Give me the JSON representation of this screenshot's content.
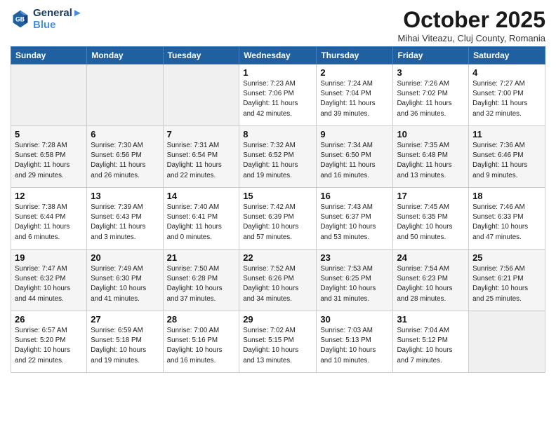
{
  "header": {
    "logo_line1": "General",
    "logo_line2": "Blue",
    "month": "October 2025",
    "location": "Mihai Viteazu, Cluj County, Romania"
  },
  "weekdays": [
    "Sunday",
    "Monday",
    "Tuesday",
    "Wednesday",
    "Thursday",
    "Friday",
    "Saturday"
  ],
  "weeks": [
    [
      {
        "day": "",
        "info": ""
      },
      {
        "day": "",
        "info": ""
      },
      {
        "day": "",
        "info": ""
      },
      {
        "day": "1",
        "info": "Sunrise: 7:23 AM\nSunset: 7:06 PM\nDaylight: 11 hours\nand 42 minutes."
      },
      {
        "day": "2",
        "info": "Sunrise: 7:24 AM\nSunset: 7:04 PM\nDaylight: 11 hours\nand 39 minutes."
      },
      {
        "day": "3",
        "info": "Sunrise: 7:26 AM\nSunset: 7:02 PM\nDaylight: 11 hours\nand 36 minutes."
      },
      {
        "day": "4",
        "info": "Sunrise: 7:27 AM\nSunset: 7:00 PM\nDaylight: 11 hours\nand 32 minutes."
      }
    ],
    [
      {
        "day": "5",
        "info": "Sunrise: 7:28 AM\nSunset: 6:58 PM\nDaylight: 11 hours\nand 29 minutes."
      },
      {
        "day": "6",
        "info": "Sunrise: 7:30 AM\nSunset: 6:56 PM\nDaylight: 11 hours\nand 26 minutes."
      },
      {
        "day": "7",
        "info": "Sunrise: 7:31 AM\nSunset: 6:54 PM\nDaylight: 11 hours\nand 22 minutes."
      },
      {
        "day": "8",
        "info": "Sunrise: 7:32 AM\nSunset: 6:52 PM\nDaylight: 11 hours\nand 19 minutes."
      },
      {
        "day": "9",
        "info": "Sunrise: 7:34 AM\nSunset: 6:50 PM\nDaylight: 11 hours\nand 16 minutes."
      },
      {
        "day": "10",
        "info": "Sunrise: 7:35 AM\nSunset: 6:48 PM\nDaylight: 11 hours\nand 13 minutes."
      },
      {
        "day": "11",
        "info": "Sunrise: 7:36 AM\nSunset: 6:46 PM\nDaylight: 11 hours\nand 9 minutes."
      }
    ],
    [
      {
        "day": "12",
        "info": "Sunrise: 7:38 AM\nSunset: 6:44 PM\nDaylight: 11 hours\nand 6 minutes."
      },
      {
        "day": "13",
        "info": "Sunrise: 7:39 AM\nSunset: 6:43 PM\nDaylight: 11 hours\nand 3 minutes."
      },
      {
        "day": "14",
        "info": "Sunrise: 7:40 AM\nSunset: 6:41 PM\nDaylight: 11 hours\nand 0 minutes."
      },
      {
        "day": "15",
        "info": "Sunrise: 7:42 AM\nSunset: 6:39 PM\nDaylight: 10 hours\nand 57 minutes."
      },
      {
        "day": "16",
        "info": "Sunrise: 7:43 AM\nSunset: 6:37 PM\nDaylight: 10 hours\nand 53 minutes."
      },
      {
        "day": "17",
        "info": "Sunrise: 7:45 AM\nSunset: 6:35 PM\nDaylight: 10 hours\nand 50 minutes."
      },
      {
        "day": "18",
        "info": "Sunrise: 7:46 AM\nSunset: 6:33 PM\nDaylight: 10 hours\nand 47 minutes."
      }
    ],
    [
      {
        "day": "19",
        "info": "Sunrise: 7:47 AM\nSunset: 6:32 PM\nDaylight: 10 hours\nand 44 minutes."
      },
      {
        "day": "20",
        "info": "Sunrise: 7:49 AM\nSunset: 6:30 PM\nDaylight: 10 hours\nand 41 minutes."
      },
      {
        "day": "21",
        "info": "Sunrise: 7:50 AM\nSunset: 6:28 PM\nDaylight: 10 hours\nand 37 minutes."
      },
      {
        "day": "22",
        "info": "Sunrise: 7:52 AM\nSunset: 6:26 PM\nDaylight: 10 hours\nand 34 minutes."
      },
      {
        "day": "23",
        "info": "Sunrise: 7:53 AM\nSunset: 6:25 PM\nDaylight: 10 hours\nand 31 minutes."
      },
      {
        "day": "24",
        "info": "Sunrise: 7:54 AM\nSunset: 6:23 PM\nDaylight: 10 hours\nand 28 minutes."
      },
      {
        "day": "25",
        "info": "Sunrise: 7:56 AM\nSunset: 6:21 PM\nDaylight: 10 hours\nand 25 minutes."
      }
    ],
    [
      {
        "day": "26",
        "info": "Sunrise: 6:57 AM\nSunset: 5:20 PM\nDaylight: 10 hours\nand 22 minutes."
      },
      {
        "day": "27",
        "info": "Sunrise: 6:59 AM\nSunset: 5:18 PM\nDaylight: 10 hours\nand 19 minutes."
      },
      {
        "day": "28",
        "info": "Sunrise: 7:00 AM\nSunset: 5:16 PM\nDaylight: 10 hours\nand 16 minutes."
      },
      {
        "day": "29",
        "info": "Sunrise: 7:02 AM\nSunset: 5:15 PM\nDaylight: 10 hours\nand 13 minutes."
      },
      {
        "day": "30",
        "info": "Sunrise: 7:03 AM\nSunset: 5:13 PM\nDaylight: 10 hours\nand 10 minutes."
      },
      {
        "day": "31",
        "info": "Sunrise: 7:04 AM\nSunset: 5:12 PM\nDaylight: 10 hours\nand 7 minutes."
      },
      {
        "day": "",
        "info": ""
      }
    ]
  ]
}
